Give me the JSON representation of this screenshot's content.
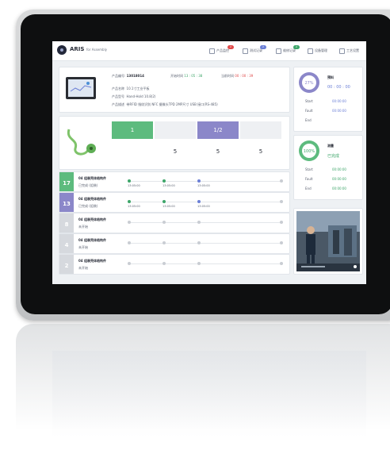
{
  "header": {
    "brand": "ARIS",
    "brand_sub": "for Assembly",
    "nav": [
      {
        "label": "产品监控",
        "badge": "2",
        "badge_color": "#e04a4a"
      },
      {
        "label": "测试记录",
        "badge": "2",
        "badge_color": "#6b7fd6"
      },
      {
        "label": "维修记录",
        "badge": "2",
        "badge_color": "#3ea66a"
      },
      {
        "label": "设备管理",
        "badge": "",
        "badge_color": ""
      },
      {
        "label": "工艺设置",
        "badge": "",
        "badge_color": ""
      }
    ]
  },
  "product": {
    "code_label": "产品编号:",
    "code_value": "13018014",
    "time_label": "开始时间",
    "time_value": "13 : 05 : 38",
    "elapsed_label": "当前时间",
    "elapsed_value": "00 : 00 : 39",
    "name_label": "产品名称",
    "name_value": "10.1寸工业平板",
    "model_label": "产品型号",
    "model_value": "Hand-Hold 10.8(2)",
    "desc_label": "产品描述",
    "desc_value": "带RFID 指纹识别 NFC 摄像头TPD 2MP尺寸 USB 接口(RS-485)"
  },
  "stats": {
    "cells": [
      "1",
      "",
      "1/2",
      ""
    ],
    "values": [
      "",
      "5",
      "5",
      "5"
    ]
  },
  "right_top": {
    "percent": "27%",
    "title": "预料",
    "time": "00 : 00 : 00",
    "rows": [
      {
        "label": "Start",
        "value": "00:00:00"
      },
      {
        "label": "Fault",
        "value": "00:00:00"
      },
      {
        "label": "End",
        "value": ""
      }
    ]
  },
  "right_mid": {
    "percent": "100%",
    "title": "测量",
    "status": "已完成",
    "rows": [
      {
        "label": "Start",
        "value": "00:00:00"
      },
      {
        "label": "Fault",
        "value": "00:00:00"
      },
      {
        "label": "End",
        "value": "00:00:00"
      }
    ]
  },
  "rows": [
    {
      "num": "17",
      "tile_color": "#5dbb7e",
      "title": "04 组装壳体结构件",
      "sub": "已完成 (组装)",
      "times": [
        "13:05:00",
        "13:05:00",
        "13:05:00"
      ],
      "dots": [
        "#3ea66a",
        "#3ea66a",
        "#6b7fd6"
      ]
    },
    {
      "num": "13",
      "tile_color": "#8b87c9",
      "title": "04 组装壳体结构件",
      "sub": "已完成 (组装)",
      "times": [
        "13:05:00",
        "13:05:00",
        "13:05:00"
      ],
      "dots": [
        "#3ea66a",
        "#3ea66a",
        "#6b7fd6"
      ]
    },
    {
      "num": "8",
      "tile_color": "#d6d9de",
      "title": "04 组装壳体结构件",
      "sub": "未开始",
      "times": [
        "",
        "",
        ""
      ],
      "dots": [
        "#c9cdd3",
        "#c9cdd3",
        "#c9cdd3"
      ]
    },
    {
      "num": "4",
      "tile_color": "#d6d9de",
      "title": "04 组装壳体结构件",
      "sub": "未开始",
      "times": [
        "",
        "",
        ""
      ],
      "dots": [
        "#c9cdd3",
        "#c9cdd3",
        "#c9cdd3"
      ]
    },
    {
      "num": "2",
      "tile_color": "#d6d9de",
      "title": "04 组装壳体结构件",
      "sub": "未开始",
      "times": [
        "",
        "",
        ""
      ],
      "dots": [
        "#c9cdd3",
        "#c9cdd3",
        "#c9cdd3"
      ]
    }
  ]
}
